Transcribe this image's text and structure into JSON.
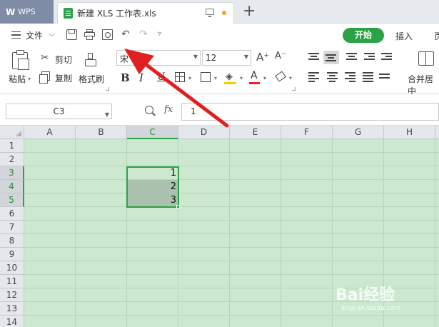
{
  "tabbar": {
    "wps_logo": "W",
    "wps_label": "WPS",
    "doc_title": "新建 XLS 工作表.xls",
    "new_tab": "+"
  },
  "menubar": {
    "file_label": "文件",
    "tabs": [
      "开始",
      "插入",
      "页"
    ],
    "active_tab": "开始"
  },
  "ribbon": {
    "paste_label": "粘贴",
    "cut_label": "剪切",
    "copy_label": "复制",
    "format_painter_label": "格式刷",
    "font_name": "宋",
    "font_size": "12",
    "grow_font": "A⁺",
    "shrink_font": "A⁻",
    "bold": "B",
    "italic": "I",
    "underline": "U",
    "font_color_glyph": "A",
    "merge_label": "合并居中"
  },
  "formula_bar": {
    "name_box": "C3",
    "fx_label": "fx",
    "formula_value": "1"
  },
  "grid": {
    "columns": [
      "A",
      "B",
      "C",
      "D",
      "E",
      "F",
      "G",
      "H"
    ],
    "rows": [
      "1",
      "2",
      "3",
      "4",
      "5",
      "6",
      "7",
      "8",
      "9",
      "10",
      "11",
      "12",
      "13",
      "14"
    ],
    "selected_column": "C",
    "selected_rows": [
      "3",
      "4",
      "5"
    ],
    "cells": {
      "C3": "1",
      "C4": "2",
      "C5": "3"
    }
  },
  "colors": {
    "accent_green": "#2ba245",
    "grid_bg": "#cce8cf",
    "arrow_red": "#e02020",
    "wps_tab_bg": "#7e8ca6"
  },
  "icons": [
    "hamburger-icon",
    "save-icon",
    "print-icon",
    "print-preview-icon",
    "undo-icon",
    "redo-icon",
    "paste-icon",
    "scissors-icon",
    "copy-icon",
    "format-painter-icon",
    "border-icon",
    "fill-color-icon",
    "font-color-icon",
    "eraser-icon",
    "merge-center-icon",
    "zoom-icon",
    "red-arrow-annotation"
  ],
  "watermark": {
    "brand": "Bai经验",
    "url": "jingyan.baidu.com"
  }
}
